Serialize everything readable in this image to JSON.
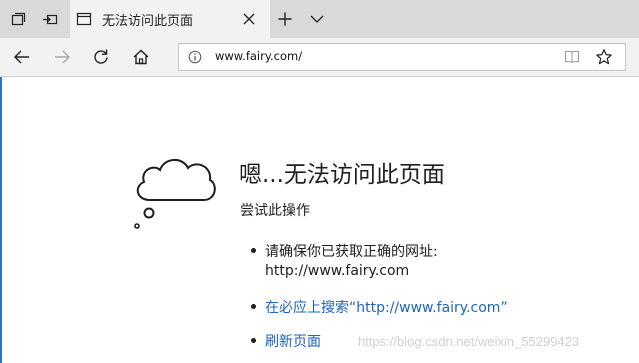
{
  "tab": {
    "title": "无法访问此页面"
  },
  "address_bar": {
    "url": "www.fairy.com/"
  },
  "error": {
    "heading": "嗯...无法访问此页面",
    "subheading": "尝试此操作",
    "suggestions": [
      {
        "line1": "请确保你已获取正确的网址:",
        "line2": "http://www.fairy.com"
      },
      {
        "label": "在必应上搜索“http://www.fairy.com”"
      },
      {
        "label": "刷新页面"
      }
    ]
  },
  "watermark": "https://blog.csdn.net/weixin_55299423",
  "colors": {
    "link": "#1a66c2",
    "tabbar": "#d9d9d9",
    "toolbar": "#f2f2f2",
    "accent_edge": "#2b74d0"
  },
  "icons": [
    "tab-actions-icon",
    "set-aside-tabs-icon",
    "page-icon",
    "close-icon",
    "new-tab-icon",
    "chevron-down-icon",
    "back-arrow-icon",
    "forward-arrow-icon",
    "refresh-icon",
    "home-icon",
    "info-icon",
    "reading-view-icon",
    "favorite-star-icon",
    "cloud-icon"
  ]
}
